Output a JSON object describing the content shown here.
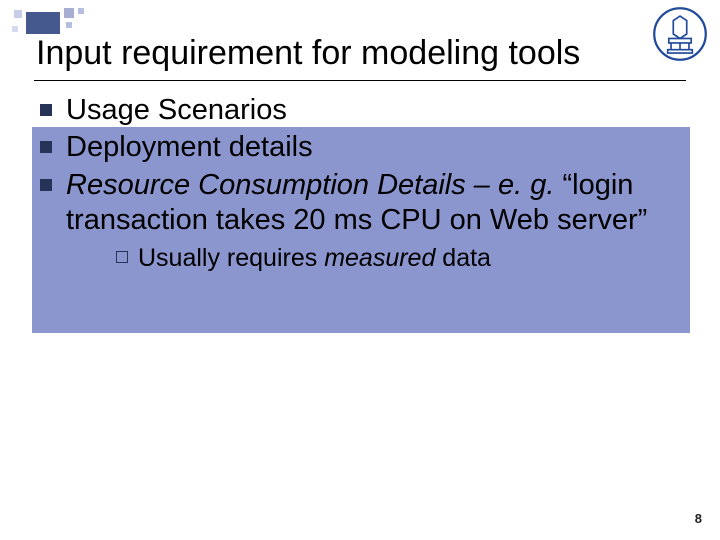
{
  "title": "Input requirement for modeling tools",
  "bullets": [
    {
      "text": "Usage Scenarios",
      "emphasis": "none",
      "highlighted": false
    },
    {
      "text": "Deployment details",
      "emphasis": "none",
      "highlighted": true
    },
    {
      "prefix": "Resource Consumption Details – e. g.",
      "prefix_emphasis": "italic",
      "rest": " “login transaction takes 20 ms CPU on Web server”",
      "highlighted": true,
      "sub": {
        "pre": "Usually requires ",
        "em": "measured",
        "post": " data"
      }
    }
  ],
  "page_number": "8",
  "colors": {
    "highlight_fill": "#8b95ce",
    "bullet_dark": "#263356",
    "motif_main": "#46598f",
    "crest_blue": "#224a9a"
  }
}
